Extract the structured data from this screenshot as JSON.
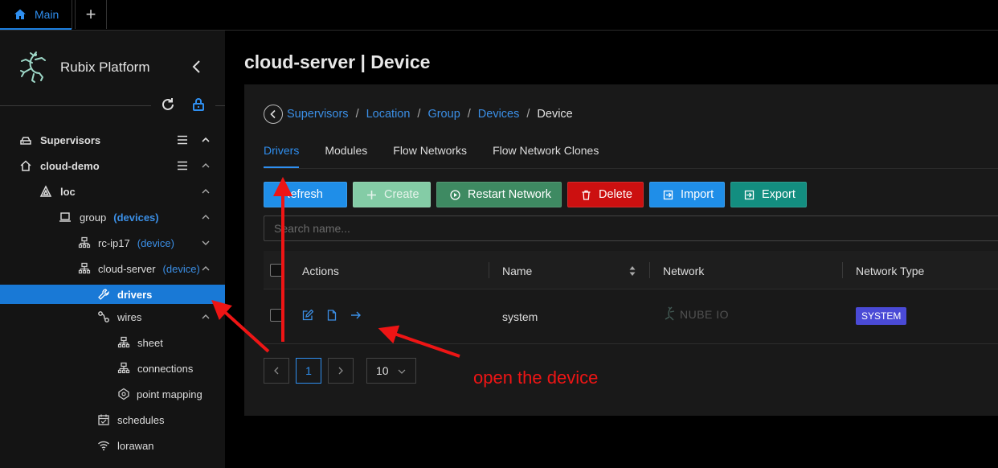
{
  "topbar": {
    "main_tab": "Main",
    "add_tab": "+"
  },
  "sidebar": {
    "brand": "Rubix Platform",
    "tree": [
      {
        "label": "Supervisors",
        "tag": ""
      },
      {
        "label": "cloud-demo",
        "tag": ""
      },
      {
        "label": "loc",
        "tag": ""
      },
      {
        "label": "group",
        "tag": "(devices)"
      },
      {
        "label": "rc-ip17",
        "tag": "(device)"
      },
      {
        "label": "cloud-server",
        "tag": "(device)"
      },
      {
        "label": "drivers",
        "tag": ""
      },
      {
        "label": "wires",
        "tag": ""
      },
      {
        "label": "sheet",
        "tag": ""
      },
      {
        "label": "connections",
        "tag": ""
      },
      {
        "label": "point mapping",
        "tag": ""
      },
      {
        "label": "schedules",
        "tag": ""
      },
      {
        "label": "lorawan",
        "tag": ""
      }
    ]
  },
  "page": {
    "title": "cloud-server | Device"
  },
  "breadcrumb": {
    "links": [
      "Supervisors",
      "Location",
      "Group",
      "Devices"
    ],
    "separator": "/",
    "current": "Device"
  },
  "tabs": [
    "Drivers",
    "Modules",
    "Flow Networks",
    "Flow Network Clones"
  ],
  "toolbar": {
    "refresh": "Refresh",
    "create": "Create",
    "restart": "Restart Network",
    "delete": "Delete",
    "import": "Import",
    "export": "Export"
  },
  "search": {
    "placeholder": "Search name..."
  },
  "table": {
    "columns": [
      "Actions",
      "Name",
      "Network",
      "Network Type"
    ],
    "rows": [
      {
        "name": "system",
        "network": "NUBE IO",
        "network_type": "SYSTEM"
      }
    ]
  },
  "pagination": {
    "current_page": "1",
    "page_size": "10"
  },
  "annotation": {
    "text": "open the device",
    "color": "#ee1515"
  },
  "colors": {
    "accent": "#1979d6",
    "link": "#3b8fe6",
    "delete": "#cc1010",
    "restart": "#3e8a62",
    "export": "#138e80",
    "badge": "#4a4ad6"
  }
}
